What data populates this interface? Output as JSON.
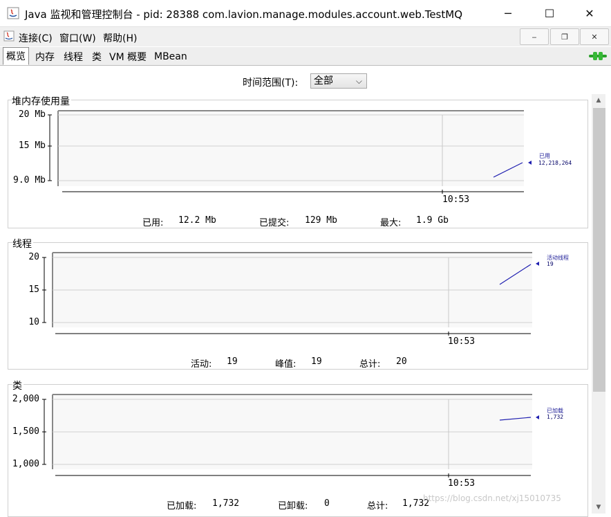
{
  "window": {
    "title": "Java 监视和管理控制台 - pid: 28388 com.lavion.manage.modules.account.web.TestMQ",
    "controls": {
      "minimize": "─",
      "maximize": "☐",
      "close": "✕"
    }
  },
  "menu": {
    "items": [
      "连接(C)",
      "窗口(W)",
      "帮助(H)"
    ],
    "mdi_controls": {
      "minimize": "‒",
      "restore": "❐",
      "close": "✕"
    }
  },
  "tabs": [
    "概览",
    "内存",
    "线程",
    "类",
    "VM 概要",
    "MBean"
  ],
  "active_tab": "概览",
  "time_range": {
    "label": "时间范围(T):",
    "value": "全部"
  },
  "panels": {
    "heap": {
      "title": "堆内存使用量",
      "y_ticks": [
        "20 Mb",
        "15 Mb",
        "9.0 Mb"
      ],
      "x_tick": "10:53",
      "legend": {
        "name": "已用",
        "value": "12,218,264"
      },
      "stats": [
        {
          "label": "已用:",
          "value": "12.2 Mb"
        },
        {
          "label": "已提交:",
          "value": "129 Mb"
        },
        {
          "label": "最大:",
          "value": "1.9 Gb"
        }
      ]
    },
    "threads": {
      "title": "线程",
      "y_ticks": [
        "20",
        "15",
        "10"
      ],
      "x_tick": "10:53",
      "legend": {
        "name": "活动线程",
        "value": "19"
      },
      "stats": [
        {
          "label": "活动:",
          "value": "19"
        },
        {
          "label": "峰值:",
          "value": "19"
        },
        {
          "label": "总计:",
          "value": "20"
        }
      ]
    },
    "classes": {
      "title": "类",
      "y_ticks": [
        "2,000",
        "1,500",
        "1,000"
      ],
      "x_tick": "10:53",
      "legend": {
        "name": "已加载",
        "value": "1,732"
      },
      "stats": [
        {
          "label": "已加载:",
          "value": "1,732"
        },
        {
          "label": "已卸载:",
          "value": "0"
        },
        {
          "label": "总计:",
          "value": "1,732"
        }
      ]
    }
  },
  "watermark": "https://blog.csdn.net/xj15010735",
  "colors": {
    "series_line": "#1f1fb0",
    "grid": "#cfcfcf",
    "plot_bg": "#f8f8f8"
  }
}
